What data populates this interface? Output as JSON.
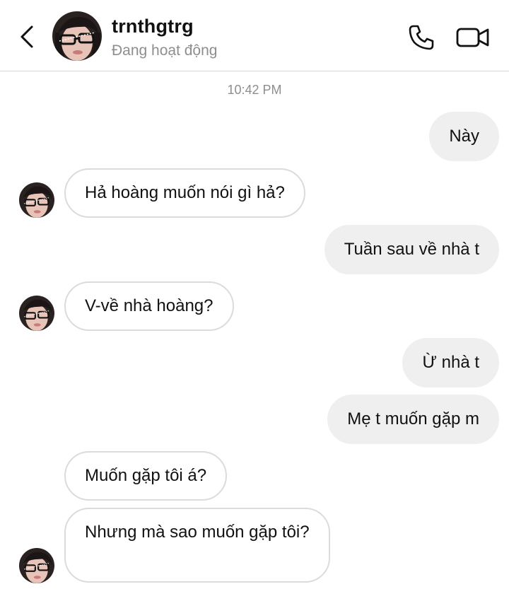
{
  "header": {
    "back_icon": "chevron-left-icon",
    "username": "trnthgtrg",
    "status": "Đang hoạt động",
    "call_icon": "phone-icon",
    "video_icon": "video-camera-icon"
  },
  "conversation": {
    "timestamp": "10:42 PM",
    "messages": [
      {
        "direction": "out",
        "text": "Này"
      },
      {
        "direction": "in",
        "text": "Hả hoàng muốn nói gì hả?"
      },
      {
        "direction": "out",
        "text": "Tuần sau về nhà t"
      },
      {
        "direction": "in",
        "text": "V-về nhà hoàng?"
      },
      {
        "direction": "out",
        "text": "Ừ nhà t"
      },
      {
        "direction": "out",
        "text": "Mẹ t muốn gặp m"
      },
      {
        "direction": "in",
        "text": "Muốn gặp tôi á?"
      },
      {
        "direction": "in",
        "text": "Nhưng mà sao muốn gặp tôi?"
      }
    ]
  },
  "colors": {
    "outgoing_bubble": "#efefef",
    "incoming_border": "#dbdbdb",
    "secondary_text": "#8e8e8e"
  }
}
